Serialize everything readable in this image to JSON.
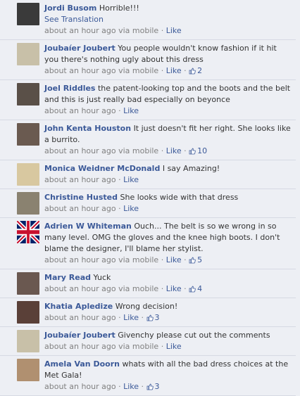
{
  "comments": [
    {
      "name": "Jordi Busom",
      "text": "Horrible!!!",
      "translate": "See Translation",
      "time": "about an hour ago via mobile",
      "sep": "·",
      "like": "Like",
      "likes": "",
      "avatar": "#3a3a3a"
    },
    {
      "name": "Joubaíer Joubert",
      "text": "You people wouldn't know fashion if it hit you there's nothing ugly about this dress",
      "translate": "",
      "time": "about an hour ago via mobile",
      "sep": "·",
      "like": "Like",
      "likes": "2",
      "avatar": "#c8c0a8"
    },
    {
      "name": "Joel Riddles",
      "text": "the patent-looking top and the boots and the belt and this is just really bad especially on beyonce",
      "translate": "",
      "time": "about an hour ago",
      "sep": "·",
      "like": "Like",
      "likes": "",
      "avatar": "#5a5048"
    },
    {
      "name": "John Kenta Houston",
      "text": "It just doesn't fit her right. She looks like a burrito.",
      "translate": "",
      "time": "about an hour ago via mobile",
      "sep": "·",
      "like": "Like",
      "likes": "10",
      "avatar": "#6a5a50"
    },
    {
      "name": "Monica Weidner McDonald",
      "text": "I say Amazing!",
      "translate": "",
      "time": "about an hour ago",
      "sep": "·",
      "like": "Like",
      "likes": "",
      "avatar": "#d8c8a0"
    },
    {
      "name": "Christine Husted",
      "text": "She looks wide with that dress",
      "translate": "",
      "time": "about an hour ago",
      "sep": "·",
      "like": "Like",
      "likes": "",
      "avatar": "#8a8270"
    },
    {
      "name": "Adrien W Whiteman",
      "text": "Ouch... The belt is so we wrong in so many level. OMG the gloves and the knee high boots. I don't blame the designer, I'll blame her stylist.",
      "translate": "",
      "time": "about an hour ago via mobile",
      "sep": "·",
      "like": "Like",
      "likes": "5",
      "avatar": "uk"
    },
    {
      "name": "Mary Read",
      "text": "Yuck",
      "translate": "",
      "time": "about an hour ago via mobile",
      "sep": "·",
      "like": "Like",
      "likes": "4",
      "avatar": "#6a5850"
    },
    {
      "name": "Khatia Apledize",
      "text": "Wrong decision!",
      "translate": "",
      "time": "about an hour ago",
      "sep": "·",
      "like": "Like",
      "likes": "3",
      "avatar": "#5a4038"
    },
    {
      "name": "Joubaíer Joubert",
      "text": "Givenchy please cut out the comments",
      "translate": "",
      "time": "about an hour ago via mobile",
      "sep": "·",
      "like": "Like",
      "likes": "",
      "avatar": "#c8c0a8"
    },
    {
      "name": "Amela Van Doorn",
      "text": "whats with all the bad dress choices at the Met Gala!",
      "translate": "",
      "time": "about an hour ago",
      "sep": "·",
      "like": "Like",
      "likes": "3",
      "avatar": "#b09070"
    }
  ]
}
